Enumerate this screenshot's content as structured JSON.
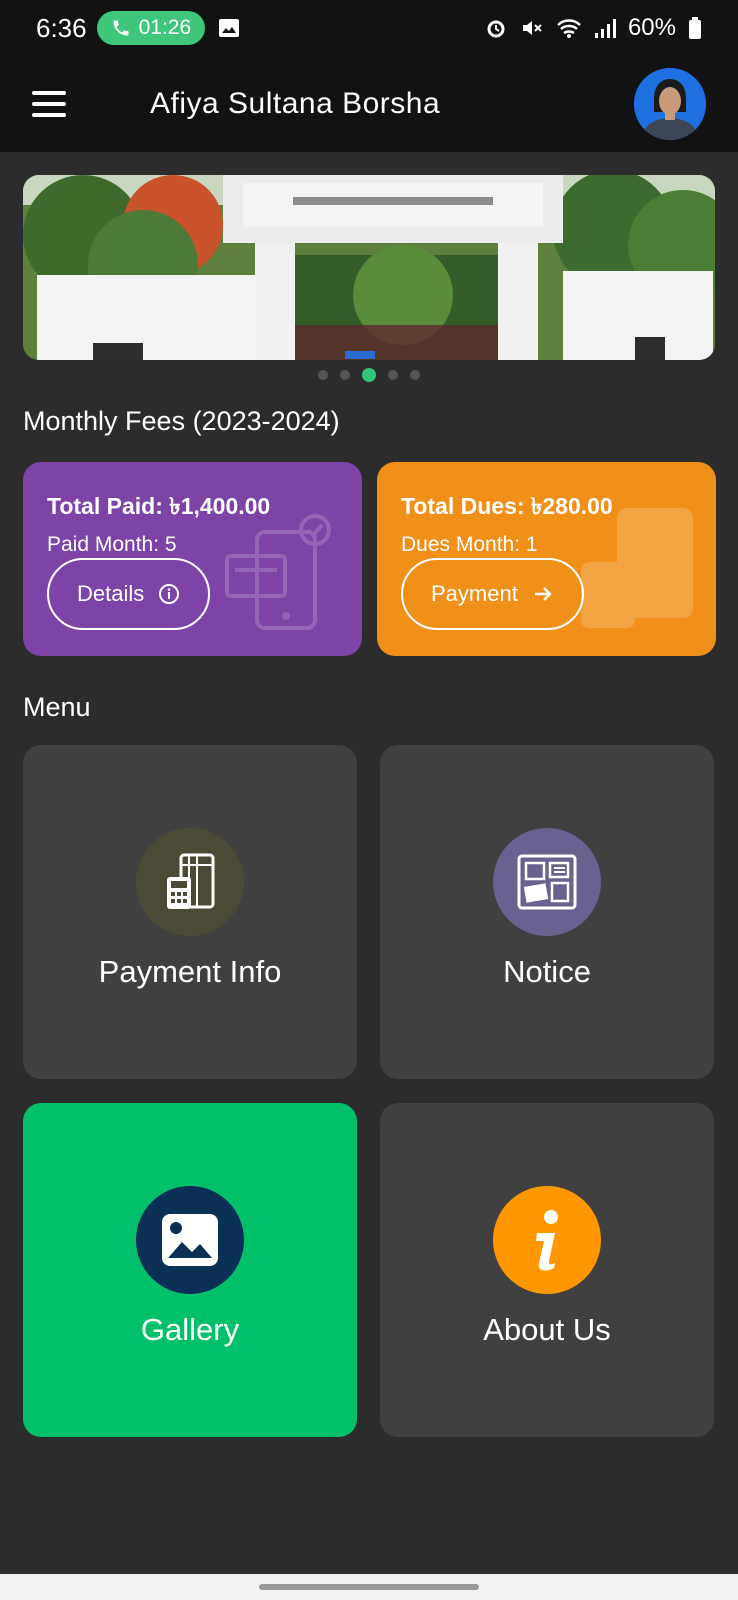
{
  "status_bar": {
    "time": "6:36",
    "call_timer": "01:26",
    "battery": "60%"
  },
  "app_bar": {
    "title": "Afiya Sultana Borsha"
  },
  "banner": {
    "slide_count": 5,
    "active_slide": 3
  },
  "fees": {
    "section_title": "Monthly Fees (2023-2024)",
    "paid": {
      "total": "Total Paid: ৳1,400.00",
      "months": "Paid Month: 5",
      "button_label": "Details"
    },
    "dues": {
      "total": "Total Dues: ৳280.00",
      "months": "Dues Month: 1",
      "button_label": "Payment"
    }
  },
  "menu": {
    "section_title": "Menu",
    "items": [
      {
        "label": "Payment Info",
        "icon": "payment-info-icon"
      },
      {
        "label": "Notice",
        "icon": "notice-board-icon"
      },
      {
        "label": "Gallery",
        "icon": "gallery-icon"
      },
      {
        "label": "About Us",
        "icon": "info-icon"
      }
    ]
  },
  "colors": {
    "paid_card": "#7d43a6",
    "dues_card": "#f09018",
    "gallery_tile": "#00c16a",
    "accent_dot": "#2fc57a"
  }
}
